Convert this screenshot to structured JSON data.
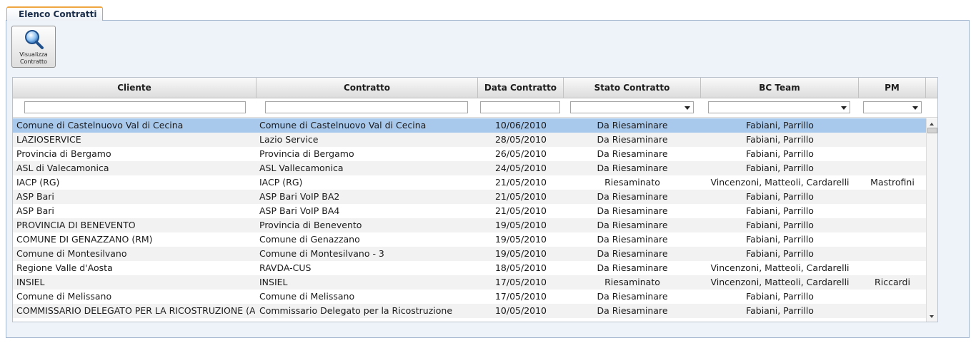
{
  "tab": {
    "label": "Elenco Contratti"
  },
  "toolbar": {
    "view_button_label": "Visualizza Contratto",
    "view_button_icon": "magnifier-icon"
  },
  "columns": [
    "Cliente",
    "Contratto",
    "Data Contratto",
    "Stato Contratto",
    "BC Team",
    "PM"
  ],
  "filters": {
    "cliente": "",
    "contratto": "",
    "data": "",
    "stato": "",
    "bc_team": "",
    "pm": ""
  },
  "rows": [
    {
      "cliente": "Comune di Castelnuovo Val di Cecina",
      "contratto": "Comune di Castelnuovo Val di Cecina",
      "data": "10/06/2010",
      "stato": "Da Riesaminare",
      "bc_team": "Fabiani, Parrillo",
      "pm": "",
      "selected": true
    },
    {
      "cliente": "LAZIOSERVICE",
      "contratto": "Lazio Service",
      "data": "28/05/2010",
      "stato": "Da Riesaminare",
      "bc_team": "Fabiani, Parrillo",
      "pm": ""
    },
    {
      "cliente": "Provincia di Bergamo",
      "contratto": "Provincia di Bergamo",
      "data": "26/05/2010",
      "stato": "Da Riesaminare",
      "bc_team": "Fabiani, Parrillo",
      "pm": ""
    },
    {
      "cliente": "ASL di Valecamonica",
      "contratto": "ASL Vallecamonica",
      "data": "24/05/2010",
      "stato": "Da Riesaminare",
      "bc_team": "Fabiani, Parrillo",
      "pm": ""
    },
    {
      "cliente": "IACP (RG)",
      "contratto": "IACP (RG)",
      "data": "21/05/2010",
      "stato": "Riesaminato",
      "bc_team": "Vincenzoni, Matteoli, Cardarelli",
      "pm": "Mastrofini"
    },
    {
      "cliente": "ASP Bari",
      "contratto": "ASP Bari VoIP BA2",
      "data": "21/05/2010",
      "stato": "Da Riesaminare",
      "bc_team": "Fabiani, Parrillo",
      "pm": ""
    },
    {
      "cliente": "ASP Bari",
      "contratto": "ASP Bari VoIP BA4",
      "data": "21/05/2010",
      "stato": "Da Riesaminare",
      "bc_team": "Fabiani, Parrillo",
      "pm": ""
    },
    {
      "cliente": "PROVINCIA DI BENEVENTO",
      "contratto": "Provincia di Benevento",
      "data": "19/05/2010",
      "stato": "Da Riesaminare",
      "bc_team": "Fabiani, Parrillo",
      "pm": ""
    },
    {
      "cliente": "COMUNE DI GENAZZANO (RM)",
      "contratto": "Comune di Genazzano",
      "data": "19/05/2010",
      "stato": "Da Riesaminare",
      "bc_team": "Fabiani, Parrillo",
      "pm": ""
    },
    {
      "cliente": "Comune di Montesilvano",
      "contratto": "Comune di Montesilvano - 3",
      "data": "19/05/2010",
      "stato": "Da Riesaminare",
      "bc_team": "Fabiani, Parrillo",
      "pm": ""
    },
    {
      "cliente": "Regione Valle d'Aosta",
      "contratto": "RAVDA-CUS",
      "data": "18/05/2010",
      "stato": "Da Riesaminare",
      "bc_team": "Vincenzoni, Matteoli, Cardarelli",
      "pm": ""
    },
    {
      "cliente": "INSIEL",
      "contratto": "INSIEL",
      "data": "17/05/2010",
      "stato": "Riesaminato",
      "bc_team": "Vincenzoni, Matteoli, Cardarelli",
      "pm": "Riccardi"
    },
    {
      "cliente": "Comune di Melissano",
      "contratto": "Comune di Melissano",
      "data": "17/05/2010",
      "stato": "Da Riesaminare",
      "bc_team": "Fabiani, Parrillo",
      "pm": ""
    },
    {
      "cliente": "COMMISSARIO DELEGATO PER LA RICOSTRUZIONE (AQ)",
      "contratto": "Commissario Delegato per la Ricostruzione",
      "data": "10/05/2010",
      "stato": "Da Riesaminare",
      "bc_team": "Fabiani, Parrillo",
      "pm": ""
    }
  ]
}
